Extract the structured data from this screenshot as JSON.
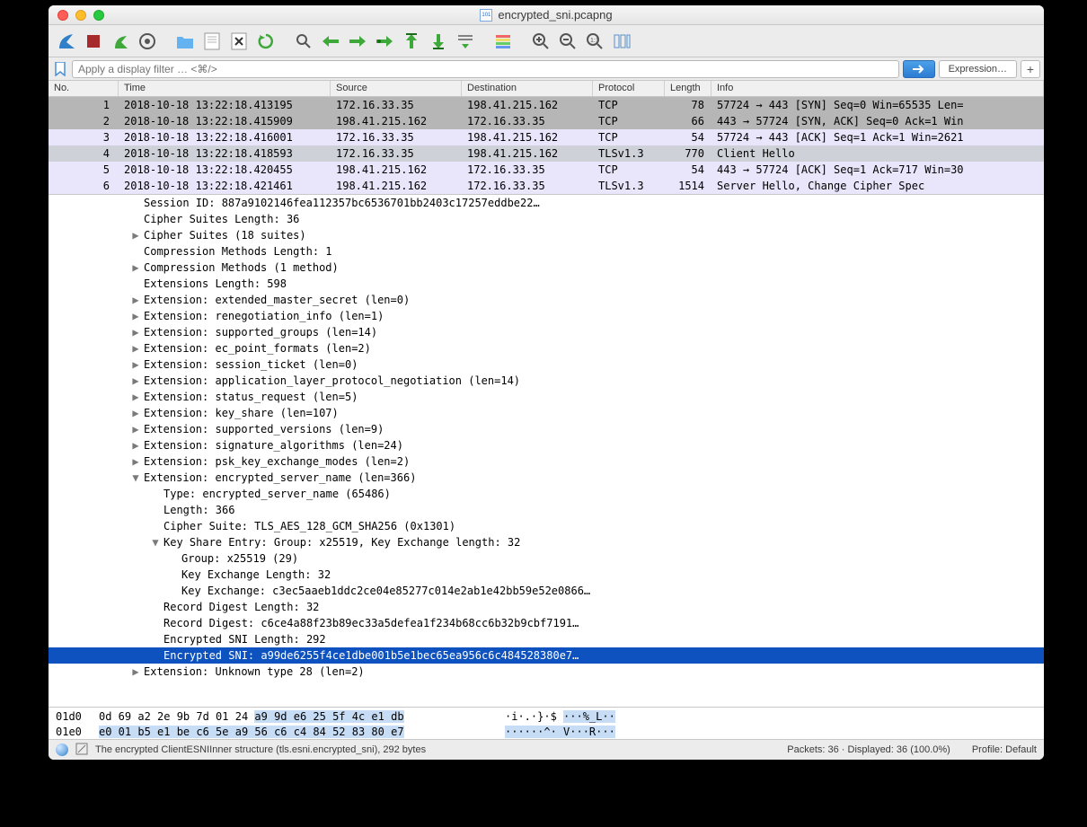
{
  "title": "encrypted_sni.pcapng",
  "filter_placeholder": "Apply a display filter … <⌘/>",
  "expression_label": "Expression…",
  "columns": {
    "no": "No.",
    "time": "Time",
    "src": "Source",
    "dst": "Destination",
    "proto": "Protocol",
    "len": "Length",
    "info": "Info"
  },
  "rows": [
    {
      "no": "1",
      "time": "2018-10-18 13:22:18.413195",
      "src": "172.16.33.35",
      "dst": "198.41.215.162",
      "proto": "TCP",
      "len": "78",
      "info": "57724 → 443 [SYN] Seq=0 Win=65535 Len=",
      "cls": "row-gray"
    },
    {
      "no": "2",
      "time": "2018-10-18 13:22:18.415909",
      "src": "198.41.215.162",
      "dst": "172.16.33.35",
      "proto": "TCP",
      "len": "66",
      "info": "443 → 57724 [SYN, ACK] Seq=0 Ack=1 Win",
      "cls": "row-gray"
    },
    {
      "no": "3",
      "time": "2018-10-18 13:22:18.416001",
      "src": "172.16.33.35",
      "dst": "198.41.215.162",
      "proto": "TCP",
      "len": "54",
      "info": "57724 → 443 [ACK] Seq=1 Ack=1 Win=2621",
      "cls": "row-lav"
    },
    {
      "no": "4",
      "time": "2018-10-18 13:22:18.418593",
      "src": "172.16.33.35",
      "dst": "198.41.215.162",
      "proto": "TLSv1.3",
      "len": "770",
      "info": "Client Hello",
      "cls": "row-sel"
    },
    {
      "no": "5",
      "time": "2018-10-18 13:22:18.420455",
      "src": "198.41.215.162",
      "dst": "172.16.33.35",
      "proto": "TCP",
      "len": "54",
      "info": "443 → 57724 [ACK] Seq=1 Ack=717 Win=30",
      "cls": "row-lav"
    },
    {
      "no": "6",
      "time": "2018-10-18 13:22:18.421461",
      "src": "198.41.215.162",
      "dst": "172.16.33.35",
      "proto": "TLSv1.3",
      "len": "1514",
      "info": "Server Hello, Change Cipher Spec",
      "cls": "row-lav"
    }
  ],
  "tree": [
    {
      "lvl": "indent-1",
      "disc": "",
      "txt": "Session ID: 887a9102146fea112357bc6536701bb2403c17257eddbe22…"
    },
    {
      "lvl": "indent-1",
      "disc": "",
      "txt": "Cipher Suites Length: 36"
    },
    {
      "lvl": "indent-1d",
      "disc": "▶",
      "txt": "Cipher Suites (18 suites)"
    },
    {
      "lvl": "indent-1",
      "disc": "",
      "txt": "Compression Methods Length: 1"
    },
    {
      "lvl": "indent-1d",
      "disc": "▶",
      "txt": "Compression Methods (1 method)"
    },
    {
      "lvl": "indent-1",
      "disc": "",
      "txt": "Extensions Length: 598"
    },
    {
      "lvl": "indent-1d",
      "disc": "▶",
      "txt": "Extension: extended_master_secret (len=0)"
    },
    {
      "lvl": "indent-1d",
      "disc": "▶",
      "txt": "Extension: renegotiation_info (len=1)"
    },
    {
      "lvl": "indent-1d",
      "disc": "▶",
      "txt": "Extension: supported_groups (len=14)"
    },
    {
      "lvl": "indent-1d",
      "disc": "▶",
      "txt": "Extension: ec_point_formats (len=2)"
    },
    {
      "lvl": "indent-1d",
      "disc": "▶",
      "txt": "Extension: session_ticket (len=0)"
    },
    {
      "lvl": "indent-1d",
      "disc": "▶",
      "txt": "Extension: application_layer_protocol_negotiation (len=14)"
    },
    {
      "lvl": "indent-1d",
      "disc": "▶",
      "txt": "Extension: status_request (len=5)"
    },
    {
      "lvl": "indent-1d",
      "disc": "▶",
      "txt": "Extension: key_share (len=107)"
    },
    {
      "lvl": "indent-1d",
      "disc": "▶",
      "txt": "Extension: supported_versions (len=9)"
    },
    {
      "lvl": "indent-1d",
      "disc": "▶",
      "txt": "Extension: signature_algorithms (len=24)"
    },
    {
      "lvl": "indent-1d",
      "disc": "▶",
      "txt": "Extension: psk_key_exchange_modes (len=2)"
    },
    {
      "lvl": "indent-1d",
      "disc": "▼",
      "txt": "Extension: encrypted_server_name (len=366)"
    },
    {
      "lvl": "indent-2",
      "disc": "",
      "txt": "Type: encrypted_server_name (65486)"
    },
    {
      "lvl": "indent-2",
      "disc": "",
      "txt": "Length: 366"
    },
    {
      "lvl": "indent-2",
      "disc": "",
      "txt": "Cipher Suite: TLS_AES_128_GCM_SHA256 (0x1301)"
    },
    {
      "lvl": "indent-2d",
      "disc": "▼",
      "txt": "Key Share Entry: Group: x25519, Key Exchange length: 32"
    },
    {
      "lvl": "indent-3",
      "disc": "",
      "txt": "Group: x25519 (29)"
    },
    {
      "lvl": "indent-3",
      "disc": "",
      "txt": "Key Exchange Length: 32"
    },
    {
      "lvl": "indent-3",
      "disc": "",
      "txt": "Key Exchange: c3ec5aaeb1ddc2ce04e85277c014e2ab1e42bb59e52e0866…"
    },
    {
      "lvl": "indent-2",
      "disc": "",
      "txt": "Record Digest Length: 32"
    },
    {
      "lvl": "indent-2",
      "disc": "",
      "txt": "Record Digest: c6ce4a88f23b89ec33a5defea1f234b68cc6b32b9cbf7191…"
    },
    {
      "lvl": "indent-2",
      "disc": "",
      "txt": "Encrypted SNI Length: 292"
    },
    {
      "lvl": "indent-2",
      "disc": "",
      "txt": "Encrypted SNI: a99de6255f4ce1dbe001b5e1bec65ea956c6c484528380e7…",
      "sel": true
    },
    {
      "lvl": "indent-1d",
      "disc": "▶",
      "txt": "Extension: Unknown type 28 (len=2)"
    }
  ],
  "hex": {
    "r1off": "01d0",
    "r1b_a": "0d 69 a2 2e 9b 7d 01 24  ",
    "r1b_b": "a9 9d e6 25 5f 4c e1 db",
    "r1a_a": "·i·.·}·$ ",
    "r1a_b": "···%_L··",
    "r2off": "01e0",
    "r2b": "e0 01 b5 e1 be c6 5e a9  56 c6 c4 84 52 83 80 e7",
    "r2a": "······^· V···R···"
  },
  "status": {
    "left": "The encrypted ClientESNIInner structure (tls.esni.encrypted_sni), 292 bytes",
    "mid": "Packets: 36 · Displayed: 36 (100.0%)",
    "right": "Profile: Default"
  }
}
